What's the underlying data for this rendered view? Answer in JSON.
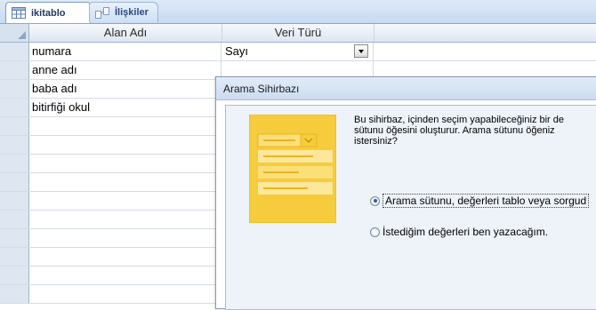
{
  "tabs": [
    {
      "label": "ikitablo",
      "active": true
    },
    {
      "label": "İlişkiler",
      "active": false
    }
  ],
  "grid": {
    "columns": [
      "Alan Adı",
      "Veri Türü"
    ],
    "rows": [
      {
        "name": "numara",
        "type": "Sayı"
      },
      {
        "name": "anne adı",
        "type": ""
      },
      {
        "name": "baba adı",
        "type": ""
      },
      {
        "name": "bitirfiği okul",
        "type": ""
      }
    ],
    "empty_rows": 10
  },
  "dialog": {
    "title": "Arama Sihirbazı",
    "intro_lines": [
      "Bu sihirbaz, içinden seçim yapabileceğiniz bir de",
      "sütunu öğesini oluşturur.  Arama sütunu öğeniz",
      "istersiniz?"
    ],
    "options": [
      {
        "label": "Arama sütunu, değerleri tablo veya sorgud",
        "selected": true
      },
      {
        "label": "İstediğim değerleri ben yazacağım.",
        "selected": false
      }
    ]
  },
  "colors": {
    "accent": "#2f5a9e",
    "illustration": "#f6cc3c"
  }
}
